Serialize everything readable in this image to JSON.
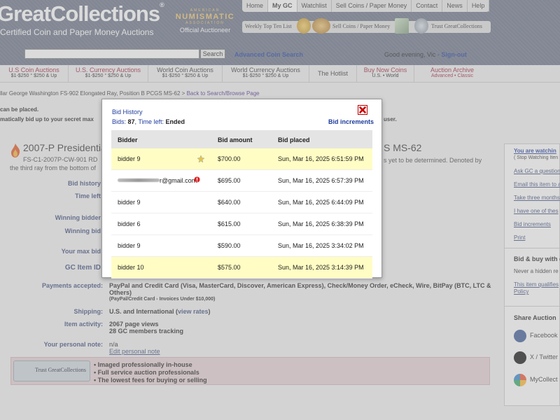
{
  "header": {
    "logo": "GreatCollections",
    "tagline": "Certified Coin and Paper Money Auctions",
    "ana_top": "AMERICAN",
    "ana_main": "NUMISMATIC",
    "ana_bottom": "ASSOCIATION",
    "ana_official": "Official Auctioneer",
    "topnav": [
      "Home",
      "My GC",
      "Watchlist",
      "Sell Coins / Paper Money",
      "Contact",
      "News",
      "Help"
    ],
    "promo": [
      "Weekly Top Ten List",
      "Sell Coins / Paper Money",
      "Trust GreatCollections"
    ],
    "search_button": "Search",
    "advanced_search": "Advanced Coin Search",
    "greeting": "Good evening, Vic - ",
    "sign_out": "Sign-out"
  },
  "catnav": [
    {
      "title": "U.S Coin Auctions",
      "sub": "$1-$250 ° $250 & Up"
    },
    {
      "title": "U.S. Currency Auctions",
      "sub": "$1-$250 ° $250 & Up"
    },
    {
      "title": "World Coin Auctions",
      "sub": "$1-$250 ° $250 & Up"
    },
    {
      "title": "World Currency Auctions",
      "sub": "$1-$250 ° $250 & Up"
    },
    {
      "title": "The Hotlist",
      "sub": ""
    },
    {
      "title": "Buy Now Coins",
      "sub": "U.S. • World"
    },
    {
      "title": "Auction Archive",
      "sub": "Advanced • Classic"
    }
  ],
  "breadcrumb": {
    "item": "llar George Washington FS-902 Elongated Ray, Position B PCGS MS-62 > ",
    "back": "Back to Search/Browse Page"
  },
  "notices": {
    "line1": "can be placed.",
    "line2a": "matically bid up to your secret max",
    "line2b": "user."
  },
  "listing": {
    "title": "2007-P Presidentia",
    "title_right": "S MS-62",
    "subtitle1": "FS-C1-2007P-CW-901 RD",
    "subtitle2": "the third ray from the bottom of",
    "subtitle_right": "s yet to be determined. Denoted by"
  },
  "details": {
    "bid_history_label": "Bid history",
    "time_left_label": "Time left",
    "winning_bidder_label": "Winning bidder",
    "winning_bid_label": "Winning bid",
    "your_max_label": "Your max bid",
    "gc_item_label": "GC Item ID",
    "payments_label": "Payments accepted:",
    "payments_value": "PayPal and Credit Card (Visa, MasterCard, Discover, American Express), Check/Money Order, eCheck, Wire, BitPay (BTC, LTC &",
    "payments_value2": "Others)",
    "payments_note": "(PayPal/Credit Card - Invoices Under $10,000)",
    "shipping_label": "Shipping:",
    "shipping_value": "U.S. and International (",
    "shipping_link": "view rates",
    "shipping_end": ")",
    "activity_label": "Item activity:",
    "activity_views": "2067 page views",
    "activity_tracking": "28 GC members tracking",
    "note_label": "Your personal note:",
    "note_value": "n/a",
    "note_edit": "Edit personal note"
  },
  "trust": {
    "seal": "Trust GreatCollections",
    "points": [
      "• Imaged professionally in-house",
      "• Full service auction professionals",
      "• The lowest fees for buying or selling"
    ]
  },
  "sidebar": {
    "watching": "You are watchin",
    "stop_watching": "( Stop Watching Iten",
    "links": [
      "Ask GC a question",
      "Email this item to a",
      "Take three months",
      "I have one of thes",
      "Bid increments",
      "Print"
    ],
    "bid_buy_head": "Bid & buy with c",
    "bid_buy_text": "Never a hidden re",
    "qualifies": "This item qualifies",
    "policy": "Policy",
    "share_head": "Share Auction",
    "social": [
      "Facebook",
      "X / Twitter",
      "MyCollect"
    ]
  },
  "modal": {
    "title": "Bid History",
    "bids_label": "Bids: ",
    "bids_count": "87",
    "time_left_label": ", Time left: ",
    "time_left_value": "Ended",
    "increments": "Bid increments",
    "columns": [
      "Bidder",
      "Bid amount",
      "Bid placed"
    ],
    "rows": [
      {
        "bidder": "bidder 9",
        "amount": "$700.00",
        "placed": "Sun, Mar 16, 2025 6:51:59 PM"
      },
      {
        "bidder": "r@gmail.com",
        "amount": "$695.00",
        "placed": "Sun, Mar 16, 2025 6:57:39 PM"
      },
      {
        "bidder": "bidder 9",
        "amount": "$640.00",
        "placed": "Sun, Mar 16, 2025 6:44:09 PM"
      },
      {
        "bidder": "bidder 6",
        "amount": "$615.00",
        "placed": "Sun, Mar 16, 2025 6:38:39 PM"
      },
      {
        "bidder": "bidder 9",
        "amount": "$590.00",
        "placed": "Sun, Mar 16, 2025 3:34:02 PM"
      },
      {
        "bidder": "bidder 10",
        "amount": "$575.00",
        "placed": "Sun, Mar 16, 2025 3:14:39 PM"
      }
    ]
  },
  "colors": {
    "header_bg": "#6a7388",
    "link_blue": "#1f3d9d",
    "highlight_row": "#fffdc4",
    "close_red": "#cc0000"
  }
}
